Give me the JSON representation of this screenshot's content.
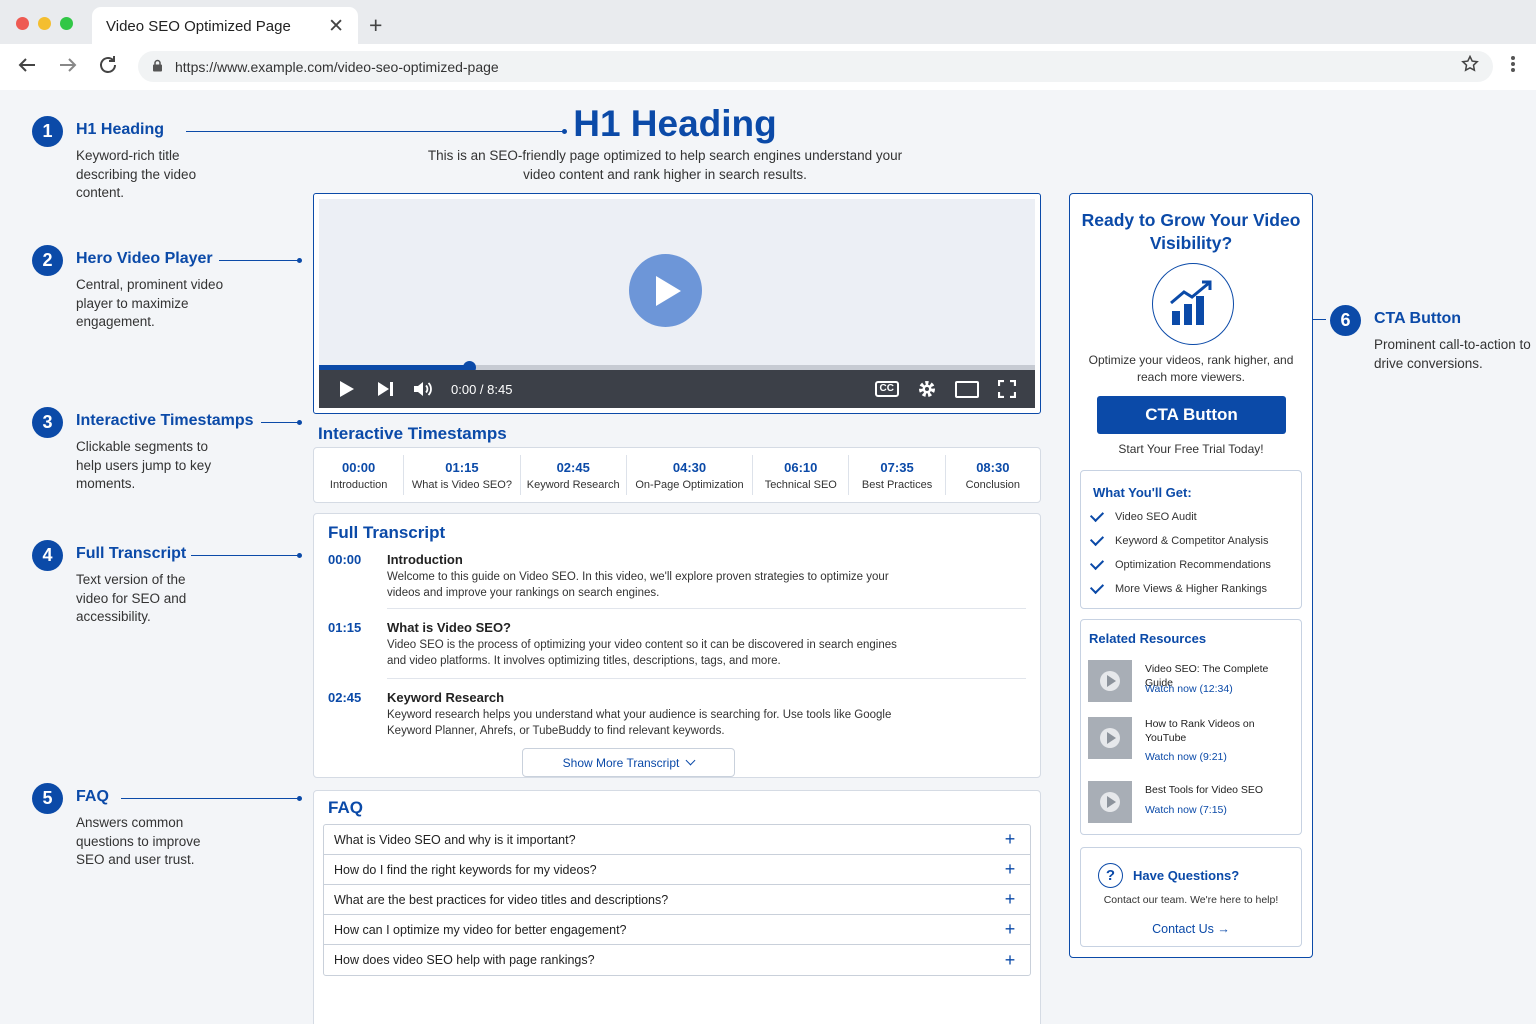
{
  "browser": {
    "tab_title": "Video SEO Optimized Page",
    "close_glyph": "✕",
    "new_tab_glyph": "+",
    "url": "https://www.example.com/video-seo-optimized-page",
    "icons": [
      "back-arrow-icon",
      "forward-arrow-icon",
      "reload-icon",
      "lock-icon",
      "star-icon",
      "kebab-menu-icon"
    ]
  },
  "annotations": [
    {
      "number": "1",
      "title": "H1 Heading",
      "desc": "Keyword-rich title describing the video content."
    },
    {
      "number": "2",
      "title": "Hero Video Player",
      "desc": "Central, prominent video player to maximize engagement."
    },
    {
      "number": "3",
      "title": "Interactive Timestamps",
      "desc": "Clickable segments to help users jump to key moments."
    },
    {
      "number": "4",
      "title": "Full Transcript",
      "desc": "Text version of the video for SEO and accessibility."
    },
    {
      "number": "5",
      "title": "FAQ",
      "desc": "Answers common questions to improve SEO and user trust."
    },
    {
      "number": "6",
      "title": "CTA Button",
      "desc": "Prominent call-to-action to drive conversions."
    }
  ],
  "main": {
    "h1": "H1 Heading",
    "intro": "This is an SEO-friendly page optimized to help search engines understand your video content and rank higher in search results."
  },
  "video": {
    "time": "0:00 / 8:45",
    "progress_fraction": 0.21,
    "cc_label": "CC",
    "accent": "#0b4aa8"
  },
  "timestamps": {
    "title": "Interactive Timestamps",
    "items": [
      {
        "time": "00:00",
        "label": "Introduction"
      },
      {
        "time": "01:15",
        "label": "What is Video SEO?"
      },
      {
        "time": "02:45",
        "label": "Keyword Research"
      },
      {
        "time": "04:30",
        "label": "On-Page Optimization"
      },
      {
        "time": "06:10",
        "label": "Technical SEO"
      },
      {
        "time": "07:35",
        "label": "Best Practices"
      },
      {
        "time": "08:30",
        "label": "Conclusion"
      }
    ]
  },
  "transcript": {
    "title": "Full Transcript",
    "items": [
      {
        "time": "00:00",
        "heading": "Introduction",
        "text": "Welcome to this guide on Video SEO. In this video, we'll explore proven strategies to optimize your videos and improve your rankings on search engines."
      },
      {
        "time": "01:15",
        "heading": "What is Video SEO?",
        "text": "Video SEO is the process of optimizing your video content so it can be discovered in search engines and video platforms. It involves optimizing titles, descriptions, tags, and more."
      },
      {
        "time": "02:45",
        "heading": "Keyword Research",
        "text": "Keyword research helps you understand what your audience is searching for. Use tools like Google Keyword Planner, Ahrefs, or TubeBuddy to find relevant keywords."
      }
    ],
    "show_more": "Show More Transcript"
  },
  "faq": {
    "title": "FAQ",
    "items": [
      "What is Video SEO and why is it important?",
      "How do I find the right keywords for my videos?",
      "What are the best practices for video titles and descriptions?",
      "How can I optimize my video for better engagement?",
      "How does video SEO help with page rankings?"
    ]
  },
  "sidebar": {
    "heading": "Ready to Grow Your Video Visibility?",
    "desc": "Optimize your videos, rank higher, and reach more viewers.",
    "cta": "CTA Button",
    "cta_sub": "Start Your Free Trial Today!",
    "get": {
      "title": "What You'll Get:",
      "items": [
        "Video SEO Audit",
        "Keyword & Competitor Analysis",
        "Optimization Recommendations",
        "More Views & Higher Rankings"
      ]
    },
    "related": {
      "title": "Related Resources",
      "items": [
        {
          "title": "Video SEO: The Complete Guide",
          "watch": "Watch now (12:34)"
        },
        {
          "title": "How to Rank Videos on YouTube",
          "watch": "Watch now (9:21)"
        },
        {
          "title": "Best Tools for Video SEO",
          "watch": "Watch now (7:15)"
        }
      ]
    },
    "questions": {
      "title": "Have Questions?",
      "desc": "Contact our team. We're here to help!",
      "link": "Contact Us →"
    }
  }
}
